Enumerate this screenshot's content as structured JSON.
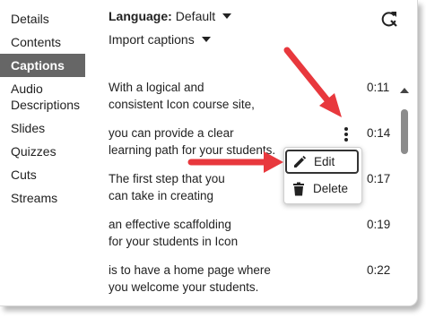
{
  "sidebar": {
    "items": [
      {
        "label": "Details"
      },
      {
        "label": "Contents"
      },
      {
        "label": "Captions",
        "active": true
      },
      {
        "label": "Audio Descriptions"
      },
      {
        "label": "Slides"
      },
      {
        "label": "Quizzes"
      },
      {
        "label": "Cuts"
      },
      {
        "label": "Streams"
      }
    ]
  },
  "toolbar": {
    "language_label": "Language:",
    "language_value": "Default",
    "import_label": "Import captions"
  },
  "captions": [
    {
      "lines": [
        "With a logical and",
        "consistent Icon course site,"
      ],
      "time": "0:11"
    },
    {
      "lines": [
        "you can provide a clear",
        "learning path for your students."
      ],
      "time": "0:14"
    },
    {
      "lines": [
        "The first step that you",
        "can take in creating"
      ],
      "time": "0:17"
    },
    {
      "lines": [
        "an effective scaffolding",
        "for your students in Icon"
      ],
      "time": "0:19"
    },
    {
      "lines": [
        "is to have a home page where",
        "you welcome your students."
      ],
      "time": "0:22"
    }
  ],
  "menu": {
    "edit_label": "Edit",
    "delete_label": "Delete"
  },
  "colors": {
    "active_bg": "#666666",
    "arrow": "#e8383d"
  }
}
